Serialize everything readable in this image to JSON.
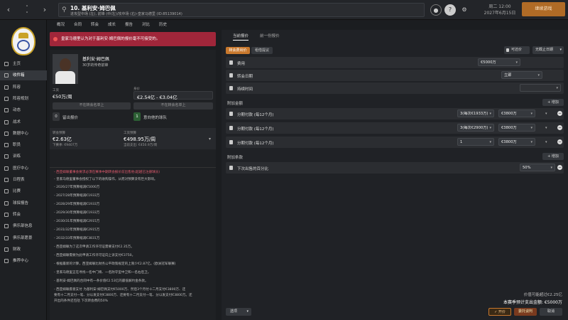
{
  "topbar": {
    "back_icon": "back-arrow-icon",
    "search_title": "10. 基利安·姆巴佩",
    "search_subtitle": "进攻型中场 (左), 前锋 (中/左)/攻中场 (右)-皇家马德里 (ID:85139014)",
    "date_line1": "周二 12:00",
    "date_line2": "2027年6月15日",
    "continue_label": "继续游戏"
  },
  "sidebar": {
    "items": [
      "主页",
      "收件箱",
      "阵容",
      "阵容规划",
      "动态",
      "战术",
      "数据中心",
      "职员",
      "训练",
      "医疗中心",
      "日程表",
      "比赛",
      "球探报告",
      "转会",
      "俱乐部信息",
      "俱乐部愿景",
      "财政",
      "推荐中心"
    ]
  },
  "menubar": {
    "items": [
      "概况",
      "合同",
      "转会",
      "成长",
      "报告",
      "对比",
      "历史"
    ]
  },
  "alert": {
    "text": "皇家马德里认为对于基利安·姆巴佩的报价毫不可接受的。"
  },
  "player": {
    "name": "基利安·姆巴佩",
    "status": "30岁的传奇前锋",
    "wage_label": "工资",
    "wage_value": "€50万/周",
    "value_label": "身价",
    "value_value": "€2.54亿 - €3.04亿",
    "not_transfer_list": "不在转会名单上",
    "not_loan_list": "不在转会名单上",
    "bids_count": "0",
    "bids_label": "留出报价",
    "interested_count": "1",
    "interested_label": "意向他的球队",
    "transfer_budget_label": "转会预算",
    "transfer_budget_value": "€2.63亿",
    "transfer_budget_sub": "下赛季: €9407万",
    "wage_budget_label": "工资预算",
    "wage_budget_value": "€498.95万/周",
    "wage_budget_sub": "当前支出: €450.9万/周"
  },
  "news": [
    "- 西亚姆联董事会要求必须在赛季中期转会报价前出售他(超越已注册球员)",
    "- 皇家马德里董事会授权了以下的收购操作，从而对预算没有巨大影响。",
    "- 2026/27年预算缩减€5000万",
    "- 2027/28年预算缩减€1933万",
    "- 2028/29年预算缩减€1933万",
    "- 2029/30年预算缩减€1933万",
    "- 2030/31年预算缩减€2915万",
    "- 2031/32年预算缩减€2915万",
    "- 2032/33年预算缩减€3831万",
    "- 西亚姆联为了这次申请工作许可证需要支付€2.35万。",
    "- 西亚姆联需要为此申请工作许可证向上诉支付€3750。",
    "- 根据最新的计算，西亚姆联比财务公平政策规定的上限少€2.87亿。(欧洲冠军联赛)",
    "- 皇家马德里正在寻找一名中门将、一名防守型中卫和一名右后卫。",
    "- 基利安·姆巴佩的合同中有一条价值€2.53亿的最低解约金条款。",
    "- 西亚姆联愿意支付 为基利安·姆巴佩支付€5000万、然后3个月付十二月支付€3800万、还",
    "要有十二月支付一笔、分以发支付€3800万、还要有十二月支付一笔、分以发支付€3800万。还",
    "开出的条件还包括 下次转会费的50%"
  ],
  "right": {
    "tabs": [
      "当前报价",
      "前一份报价"
    ],
    "subtab_active": "转会费出价",
    "subtab_other": "租借提议",
    "offer_type_btn": "可还价",
    "deadline_btn": "无截止日期",
    "fee_label": "费用",
    "fee_value": "€5000万",
    "date_label": "转会日期",
    "date_value": "立即",
    "loan_label": "持续时间",
    "loan_value": "",
    "add_fee_section": "附加金额",
    "add_btn": "增加",
    "installments": [
      {
        "label": "分期付款 (每12个月)",
        "count": "3(每次€1933万)",
        "amount": "€3800万"
      },
      {
        "label": "分期付款 (每12个月)",
        "count": "3(每次€2900万)",
        "amount": "€3800万"
      },
      {
        "label": "分期付款 (每12个月)",
        "count": "1",
        "amount": "€3800万"
      }
    ],
    "clauses_section": "附加条款",
    "clause_label": "下次出售的百分比",
    "clause_value": "50%",
    "summary_line1": "价值可能超过€2.25亿",
    "summary_line2": "本赛季预计支出金额: €5000万",
    "options_btn": "选项",
    "propose_btn": "开价",
    "assistant_btn": "委托谈判",
    "cancel_btn": "取消"
  }
}
